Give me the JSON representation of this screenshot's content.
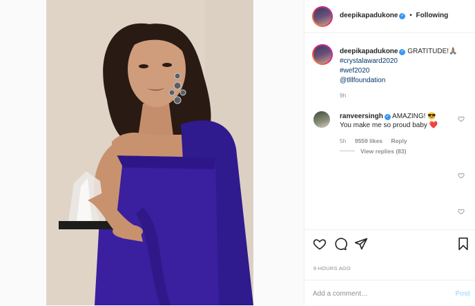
{
  "post": {
    "username": "deepikapadukone",
    "dot": "•",
    "follow_state": "Following",
    "caption": {
      "username": "deepikapadukone",
      "text": "GRATITUDE!🙏🏽",
      "tags": [
        "#crystalaward2020",
        "#wef2020",
        "@tlllfoundation"
      ],
      "time": "9h"
    },
    "comment": {
      "username": "ranveersingh",
      "text_line1": "AMAZING! 😎",
      "text_line2": "You make me so proud baby ❤️",
      "time": "5h",
      "likes": "9559 likes",
      "reply": "Reply",
      "view_replies": "View replies (83)"
    },
    "timestamp": "9 HOURS AGO",
    "add_comment_placeholder": "Add a comment…",
    "post_button": "Post"
  },
  "colors": {
    "dress": "#3a1f9e",
    "link": "#00376b",
    "verified": "#3897f0"
  },
  "icons": [
    "verified-icon",
    "heart-icon",
    "comment-icon",
    "share-icon",
    "bookmark-icon"
  ]
}
